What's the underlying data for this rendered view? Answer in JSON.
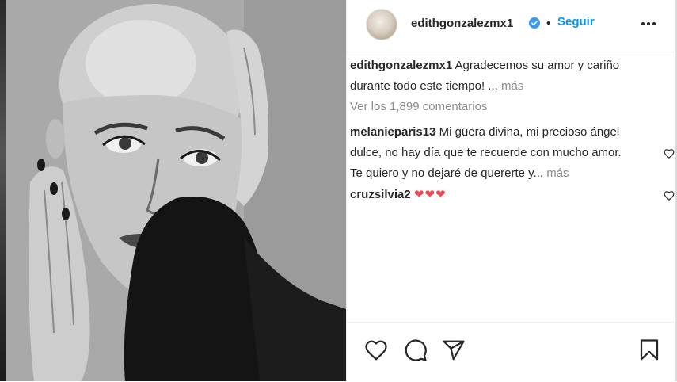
{
  "post": {
    "username": "edithgonzalezmx1",
    "follow_label": "Seguir",
    "separator": "•",
    "caption": {
      "username": "edithgonzalezmx1",
      "text_line1": "Agradecemos su amor y cariño",
      "text_line2": "durante todo este tiempo! ...",
      "more_label": "más"
    },
    "view_all_comments": "Ver los 1,899 comentarios",
    "comments": [
      {
        "username": "melanieparis13",
        "line1": "Mi güera divina, mi precioso ángel",
        "line2": "dulce, no hay día que te recuerde con mucho amor.",
        "line3": "Te quiero y no dejaré de quererte y...",
        "more_label": "más"
      },
      {
        "username": "cruzsilvia2",
        "text": "❤❤❤"
      }
    ]
  },
  "colors": {
    "link_blue": "#0095f6",
    "muted_gray": "#8e8e8e",
    "heart_red": "#ed4956",
    "verified_blue": "#3897f0"
  },
  "icons": {
    "avatar": "avatar",
    "verified": "verified-badge-icon",
    "more": "more-options-icon",
    "like": "heart-icon",
    "comment": "comment-icon",
    "share": "share-icon",
    "save": "bookmark-icon"
  }
}
